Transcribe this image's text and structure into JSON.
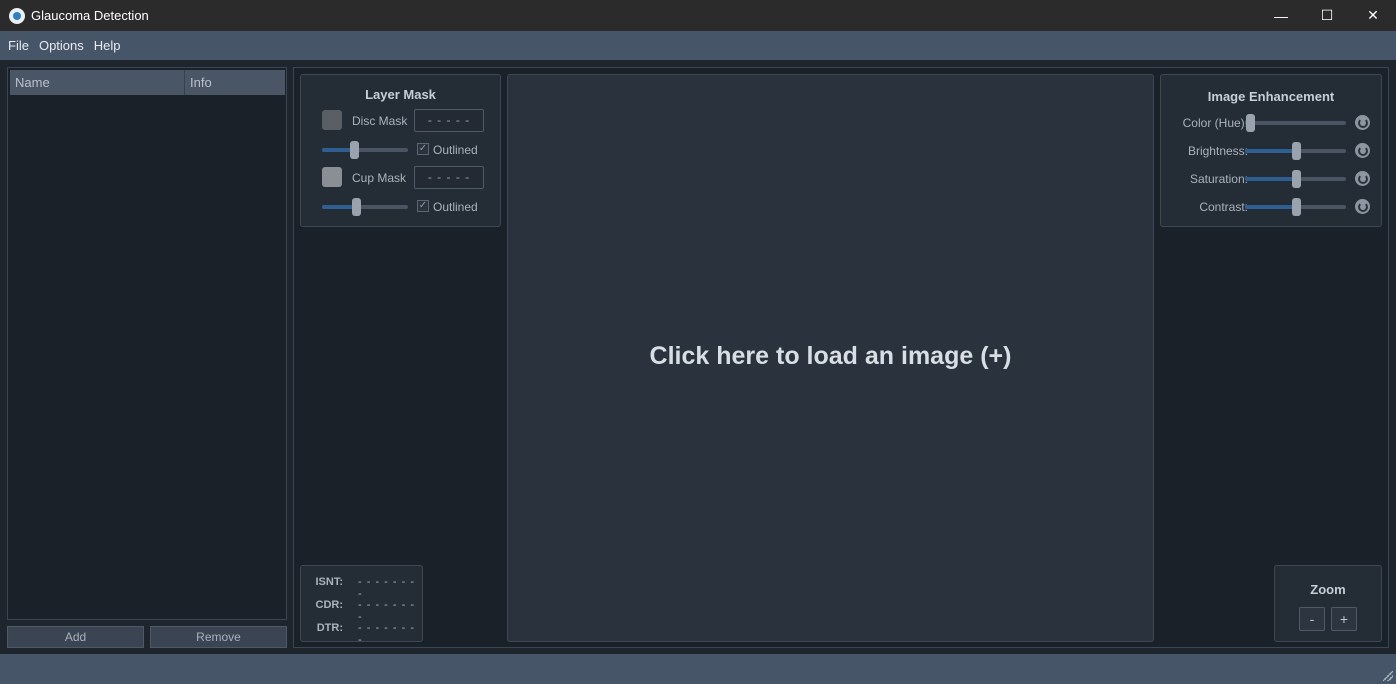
{
  "window": {
    "title": "Glaucoma Detection",
    "minimize": "—",
    "maximize": "☐",
    "close": "✕"
  },
  "menu": {
    "items": [
      "File",
      "Options",
      "Help"
    ]
  },
  "file_list": {
    "columns": [
      "Name",
      "Info"
    ],
    "rows": [],
    "add_label": "Add",
    "remove_label": "Remove"
  },
  "layer_mask": {
    "title": "Layer Mask",
    "disc": {
      "label": "Disc Mask",
      "value": "- - - - -",
      "color": "#5a5f66",
      "opacity_fraction": 0.37,
      "outlined_label": "Outlined",
      "outlined_checked": true
    },
    "cup": {
      "label": "Cup Mask",
      "value": "- - - - -",
      "color": "#8a8f96",
      "opacity_fraction": 0.4,
      "outlined_label": "Outlined",
      "outlined_checked": true
    }
  },
  "metrics": {
    "isnt_label": "ISNT:",
    "isnt_value": "- - - - - - - -",
    "cdr_label": "CDR:",
    "cdr_value": "- - - - - - - -",
    "dtr_label": "DTR:",
    "dtr_value": "- - - - - - - -"
  },
  "image_area": {
    "prompt": "Click here to load an image (+)"
  },
  "enhancement": {
    "title": "Image Enhancement",
    "sliders": [
      {
        "label": "Color (Hue):",
        "value_fraction": 0.05
      },
      {
        "label": "Brightness:",
        "value_fraction": 0.5
      },
      {
        "label": "Saturation:",
        "value_fraction": 0.5
      },
      {
        "label": "Contrast:",
        "value_fraction": 0.5
      }
    ]
  },
  "zoom": {
    "title": "Zoom",
    "minus": "-",
    "plus": "+"
  },
  "colors": {
    "accent": "#2f5f91",
    "menubar": "#465567",
    "background": "#1b2129"
  }
}
